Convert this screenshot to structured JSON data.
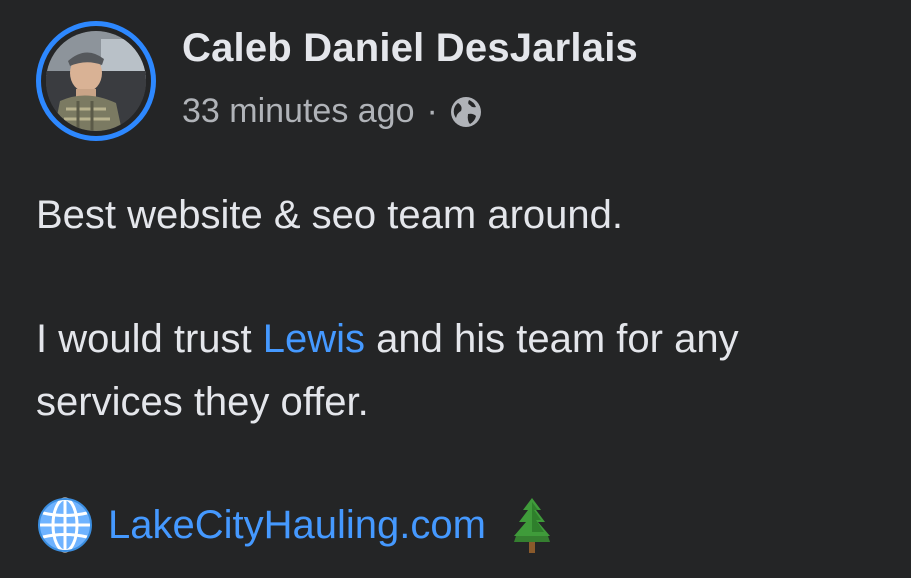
{
  "post": {
    "author": "Caleb Daniel DesJarlais",
    "timestamp": "33 minutes ago",
    "separator": "·",
    "audience_icon": "globe-icon",
    "text": {
      "line1": "Best website & seo team around.",
      "line2_before": "I would trust ",
      "mention": "Lewis",
      "line2_after": " and his team for any",
      "line3": "services they offer."
    },
    "link": {
      "prefix_icon": "globe-with-meridians-icon",
      "label": "LakeCityHauling.com",
      "suffix_icon": "evergreen-tree-icon"
    }
  },
  "colors": {
    "background": "#242526",
    "primary_text": "#e4e6eb",
    "secondary_text": "#b0b3b8",
    "link": "#4599ff",
    "avatar_ring": "#2d88ff"
  }
}
